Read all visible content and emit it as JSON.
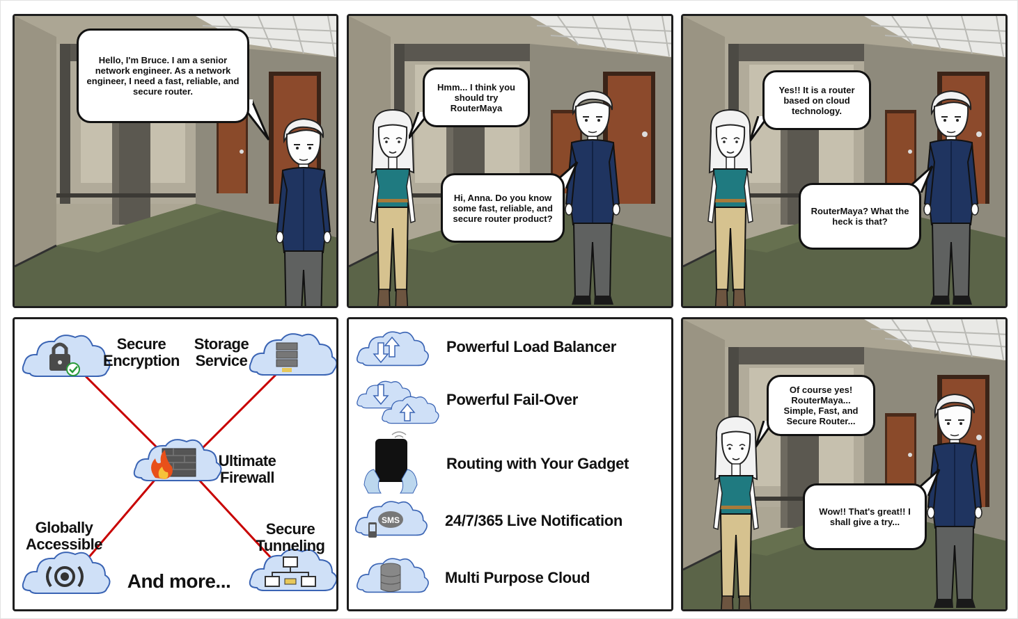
{
  "panels": {
    "p1": {
      "bubble": "Hello, I'm Bruce. I am a senior network engineer. As a network engineer, I need a fast, reliable, and secure router."
    },
    "p2": {
      "anna_bubble": "Hmm... I think you should try RouterMaya",
      "bruce_bubble": "Hi, Anna. Do you know some fast, reliable, and secure router product?"
    },
    "p3": {
      "anna_bubble": "Yes!! It is a router based on cloud technology.",
      "bruce_bubble": "RouterMaya? What the heck is that?"
    },
    "p6": {
      "anna_bubble": "Of course yes! RouterMaya... Simple, Fast, and Secure Router...",
      "bruce_bubble": "Wow!! That's great!! I shall give a try..."
    }
  },
  "features_diagram": {
    "nodes": [
      {
        "label": "Secure Encryption",
        "icon": "lock-cloud-icon"
      },
      {
        "label": "Storage Service",
        "icon": "server-cloud-icon"
      },
      {
        "label": "Ultimate Firewall",
        "icon": "firewall-cloud-icon"
      },
      {
        "label": "Globally Accessible",
        "icon": "broadcast-cloud-icon"
      },
      {
        "label": "Secure Tunneling",
        "icon": "network-cloud-icon"
      }
    ],
    "more_label": "And more...",
    "line_color": "#cc0000"
  },
  "features_list": [
    {
      "label": "Powerful Load Balancer",
      "icon": "load-balancer-cloud-icon"
    },
    {
      "label": "Powerful Fail-Over",
      "icon": "failover-clouds-icon"
    },
    {
      "label": "Routing with Your Gadget",
      "icon": "tablet-icon"
    },
    {
      "label": "24/7/365 Live Notification",
      "icon": "sms-cloud-icon"
    },
    {
      "label": "Multi Purpose Cloud",
      "icon": "database-cloud-icon"
    }
  ],
  "colors": {
    "cloud_fill": "#cfe0f7",
    "cloud_stroke": "#3a64b4",
    "wall": "#aaa596",
    "floor": "#5c6448",
    "door": "#8a4a2a"
  }
}
